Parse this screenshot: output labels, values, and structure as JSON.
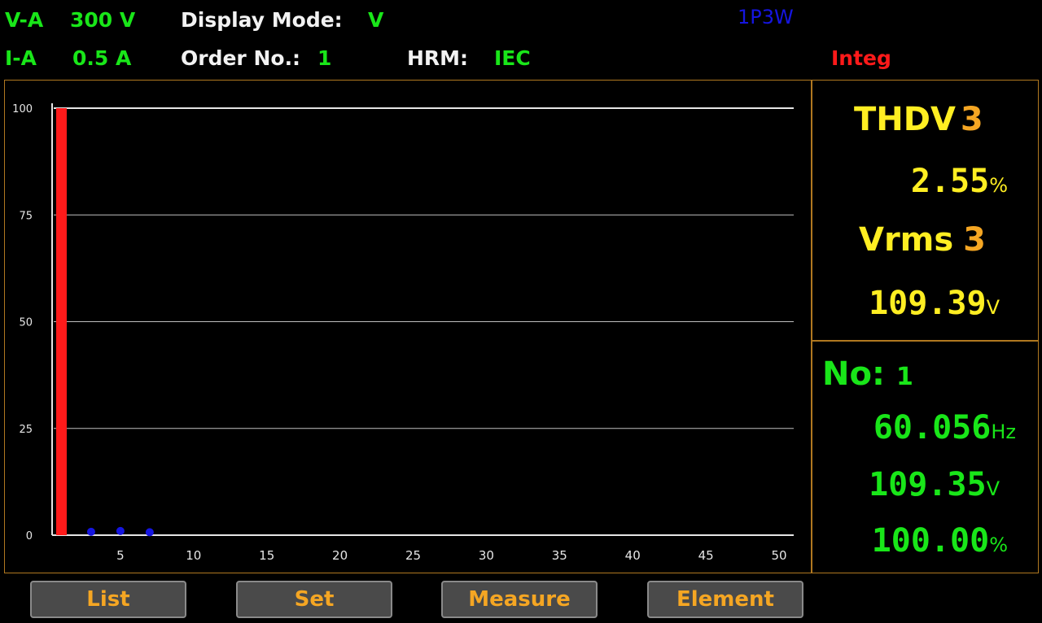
{
  "header": {
    "va_label": "V-A",
    "va_value": "300 V",
    "ia_label": "I-A",
    "ia_value": "0.5 A",
    "display_mode_label": "Display Mode:",
    "display_mode_value": "V",
    "order_label": "Order No.:",
    "order_value": "1",
    "hrm_label": "HRM:",
    "hrm_value": "IEC",
    "wiring": "1P3W",
    "integ": "Integ"
  },
  "panel": {
    "thd_label": "THDV",
    "thd_channel": "3",
    "thd_value": "2.55",
    "thd_unit": "%",
    "rms_label": "Vrms",
    "rms_channel": "3",
    "rms_value": "109.39",
    "rms_unit": "V",
    "no_label": "No:",
    "no_value": "1",
    "freq_value": "60.056",
    "freq_unit": "Hz",
    "harm_value": "109.35",
    "harm_unit": "V",
    "pct_value": "100.00",
    "pct_unit": "%"
  },
  "softkeys": [
    "List",
    "Set",
    "Measure",
    "Element"
  ],
  "colors": {
    "bar": "#ff1a1a",
    "marker": "#1515e0",
    "grid": "#bfbfbf",
    "frame": "#b07820"
  },
  "chart_data": {
    "type": "bar",
    "x": [
      1,
      3,
      5,
      7
    ],
    "values": [
      100,
      0.4,
      0.6,
      0.3
    ],
    "xticks": [
      "5",
      "10",
      "15",
      "20",
      "25",
      "30",
      "35",
      "40",
      "45",
      "50"
    ],
    "yticks": [
      "0",
      "25",
      "50",
      "75",
      "100"
    ],
    "xlim": [
      0,
      51
    ],
    "ylim": [
      0,
      100
    ],
    "grid": true
  }
}
